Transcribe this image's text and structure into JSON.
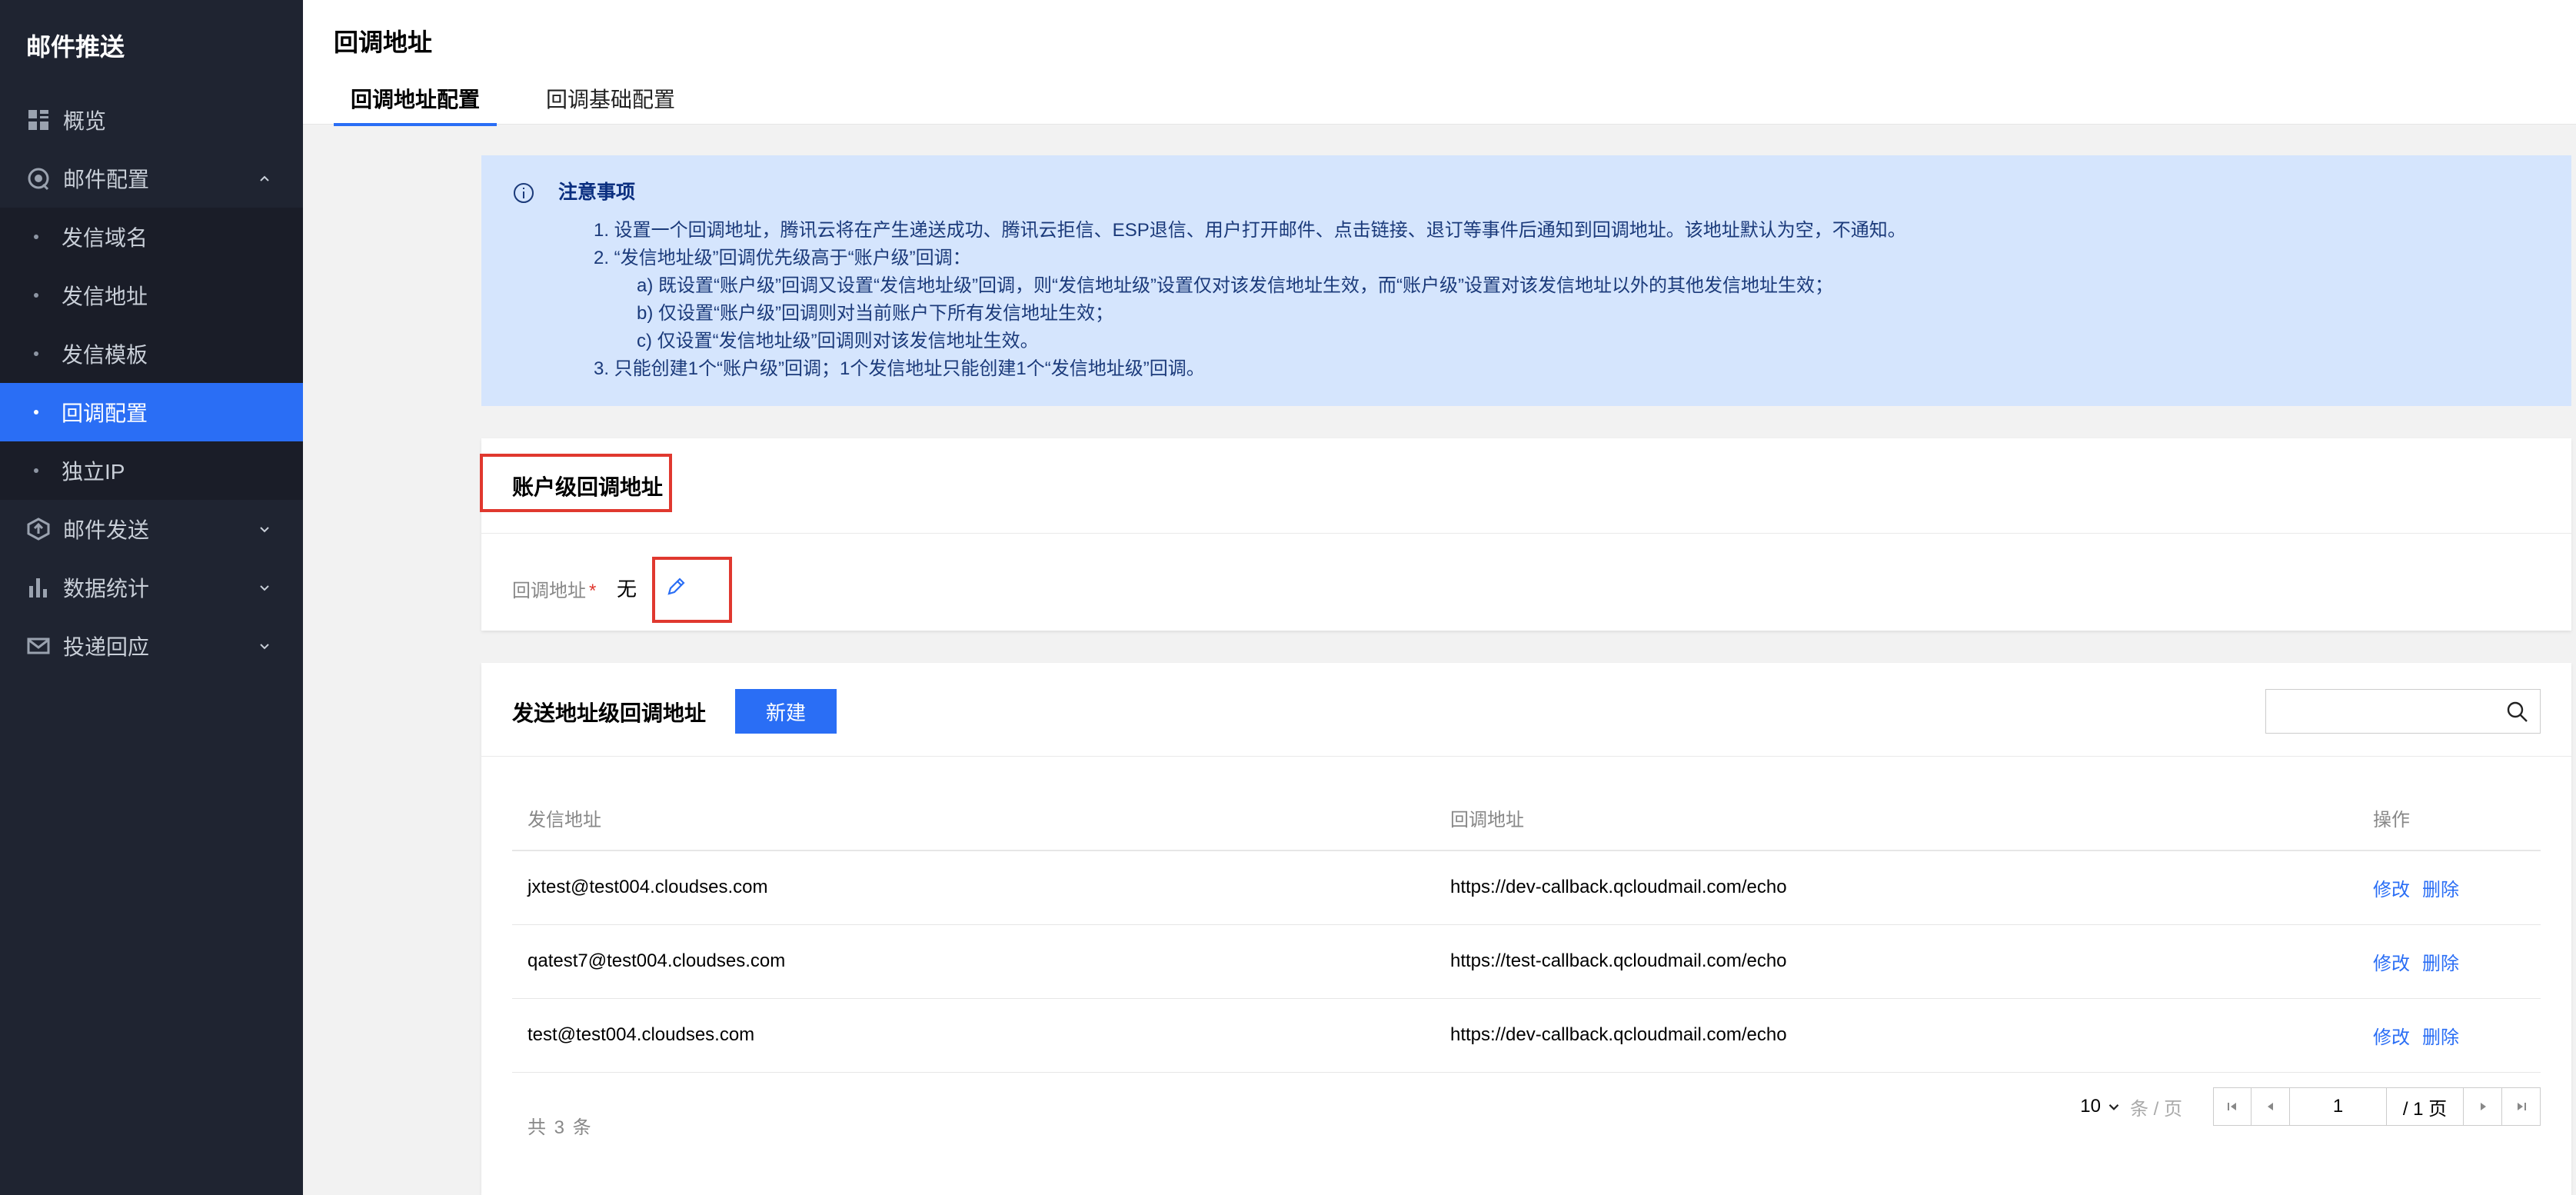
{
  "sidebar": {
    "brand": "邮件推送",
    "items": [
      {
        "label": "概览"
      },
      {
        "label": "邮件配置"
      },
      {
        "label": "邮件发送"
      },
      {
        "label": "数据统计"
      },
      {
        "label": "投递回应"
      }
    ],
    "sub_items": [
      {
        "label": "发信域名"
      },
      {
        "label": "发信地址"
      },
      {
        "label": "发信模板"
      },
      {
        "label": "回调配置"
      },
      {
        "label": "独立IP"
      }
    ]
  },
  "header": {
    "title": "回调地址",
    "tabs": [
      {
        "label": "回调地址配置"
      },
      {
        "label": "回调基础配置"
      }
    ]
  },
  "notice": {
    "title": "注意事项",
    "lines": [
      "1. 设置一个回调地址，腾讯云将在产生递送成功、腾讯云拒信、ESP退信、用户打开邮件、点击链接、退订等事件后通知到回调地址。该地址默认为空，不通知。",
      "2. “发信地址级”回调优先级高于“账户级”回调：",
      "a) 既设置“账户级”回调又设置“发信地址级”回调，则“发信地址级”设置仅对该发信地址生效，而“账户级”设置对该发信地址以外的其他发信地址生效；",
      "b) 仅设置“账户级”回调则对当前账户下所有发信地址生效；",
      "c) 仅设置“发信地址级”回调则对该发信地址生效。",
      "3. 只能创建1个“账户级”回调；1个发信地址只能创建1个“发信地址级”回调。"
    ]
  },
  "account": {
    "title": "账户级回调地址",
    "field_label": "回调地址",
    "required_mark": "*",
    "field_value": "无"
  },
  "sender": {
    "title": "发送地址级回调地址",
    "new_button": "新建",
    "search_placeholder": "",
    "columns": [
      "发信地址",
      "回调地址",
      "操作"
    ],
    "rows": [
      {
        "address": "jxtest@test004.cloudses.com",
        "callback": "https://dev-callback.qcloudmail.com/echo",
        "edit": "修改",
        "delete": "删除"
      },
      {
        "address": "qatest7@test004.cloudses.com",
        "callback": "https://test-callback.qcloudmail.com/echo",
        "edit": "修改",
        "delete": "删除"
      },
      {
        "address": "test@test004.cloudses.com",
        "callback": "https://dev-callback.qcloudmail.com/echo",
        "edit": "修改",
        "delete": "删除"
      }
    ],
    "total": "共 3 条",
    "page_size": "10",
    "page_unit": "条 / 页",
    "page_current": "1",
    "page_total": "/ 1 页"
  },
  "colors": {
    "accent": "#2a6ef5",
    "sidebar_bg": "#1f2431",
    "notice_bg": "#d5e5fd",
    "highlight": "#e0382f"
  }
}
